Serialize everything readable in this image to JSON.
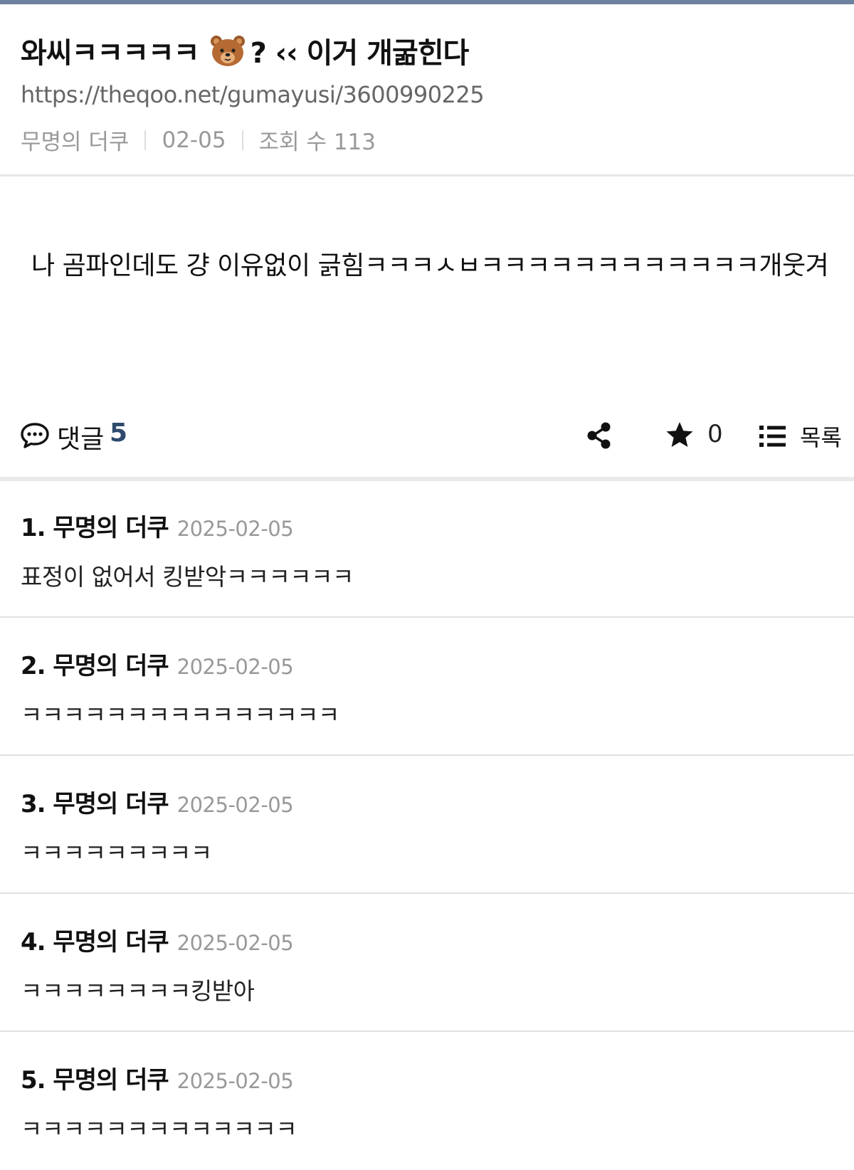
{
  "post": {
    "title_before": "와씨ㅋㅋㅋㅋㅋ",
    "title_after": "? ‹‹ 이거 개굶힌다",
    "url": "https://theqoo.net/gumayusi/3600990225",
    "author": "무명의 더쿠",
    "date": "02-05",
    "views": "조회 수 113",
    "content": "나 곰파인데도 걍 이유없이 긁힘ㅋㅋㅋㅅㅂㅋㅋㅋㅋㅋㅋㅋㅋㅋㅋㅋㅋ개웃겨"
  },
  "actions": {
    "comment_label": "댓글",
    "comment_count": "5",
    "star_count": "0",
    "list_label": "목록"
  },
  "comments": [
    {
      "author": "1. 무명의 더쿠",
      "date": "2025-02-05",
      "text": "표정이 없어서 킹받악ㅋㅋㅋㅋㅋㅋ"
    },
    {
      "author": "2. 무명의 더쿠",
      "date": "2025-02-05",
      "text": "ㅋㅋㅋㅋㅋㅋㅋㅋㅋㅋㅋㅋㅋㅋㅋ"
    },
    {
      "author": "3. 무명의 더쿠",
      "date": "2025-02-05",
      "text": "ㅋㅋㅋㅋㅋㅋㅋㅋㅋ"
    },
    {
      "author": "4. 무명의 더쿠",
      "date": "2025-02-05",
      "text": "ㅋㅋㅋㅋㅋㅋㅋㅋ킹받아"
    },
    {
      "author": "5. 무명의 더쿠",
      "date": "2025-02-05",
      "text": "ㅋㅋㅋㅋㅋㅋㅋㅋㅋㅋㅋㅋㅋ"
    }
  ],
  "colors": {
    "accent_bar": "#6e819e",
    "comment_count": "#2f4a6d"
  },
  "icons": [
    "bear-emoji-icon",
    "speech-bubble-icon",
    "share-icon",
    "star-icon",
    "list-icon"
  ]
}
